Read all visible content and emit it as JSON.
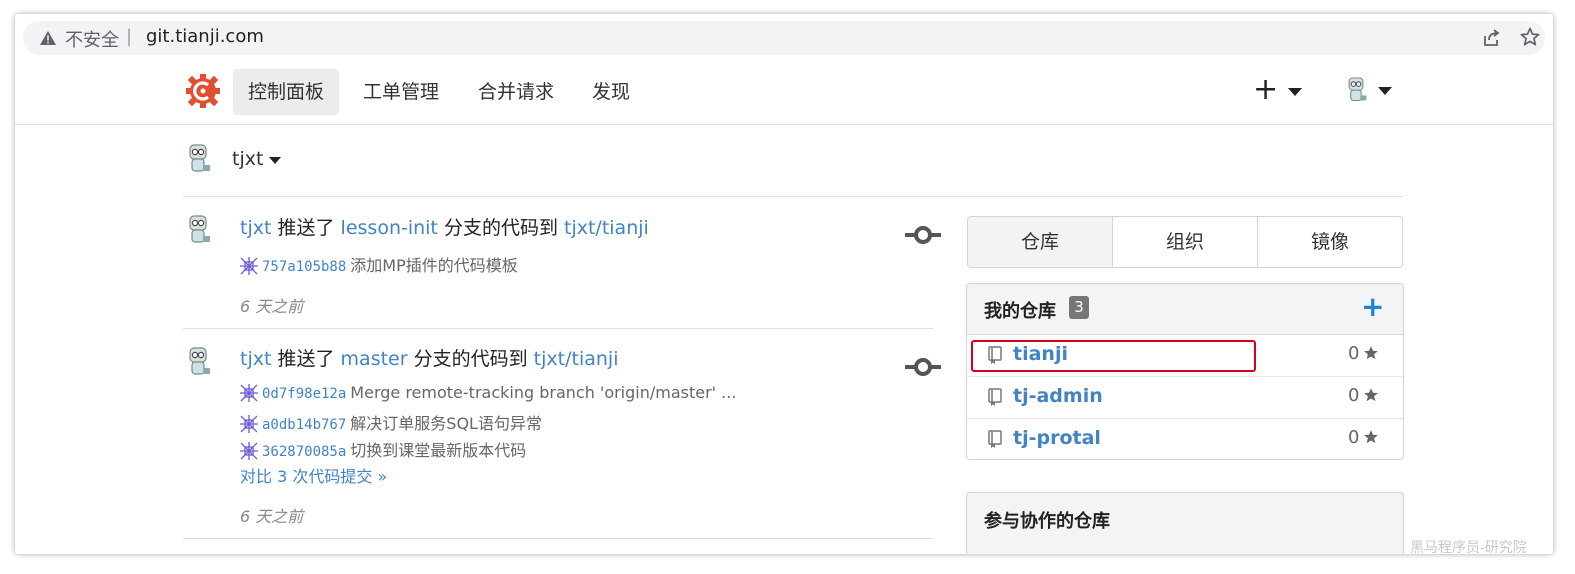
{
  "browser": {
    "security_label": "不安全",
    "separator": "|",
    "url": "git.tianji.com"
  },
  "nav": {
    "items": [
      "控制面板",
      "工单管理",
      "合并请求",
      "发现"
    ],
    "create_label": "+"
  },
  "context": {
    "user": "tjxt"
  },
  "feed": [
    {
      "user": "tjxt",
      "action": "推送了",
      "branch": "lesson-init",
      "mid": "分支的代码到",
      "repo": "tjxt/tianji",
      "commits": [
        {
          "sha": "757a105b88",
          "message": "添加MP插件的代码模板"
        }
      ],
      "compare": "",
      "time": "6 天之前"
    },
    {
      "user": "tjxt",
      "action": "推送了",
      "branch": "master",
      "mid": "分支的代码到",
      "repo": "tjxt/tianji",
      "commits": [
        {
          "sha": "0d7f98e12a",
          "message": "Merge remote-tracking branch 'origin/master' ..."
        },
        {
          "sha": "a0db14b767",
          "message": "解决订单服务SQL语句异常"
        },
        {
          "sha": "362870085a",
          "message": "切换到课堂最新版本代码"
        }
      ],
      "compare": "对比 3 次代码提交 »",
      "time": "6 天之前"
    }
  ],
  "sidebar": {
    "tabs": [
      "仓库",
      "组织",
      "镜像"
    ],
    "my_repos_title": "我的仓库",
    "my_repos_count": "3",
    "add_label": "+",
    "repos": [
      {
        "name": "tianji",
        "stars": "0"
      },
      {
        "name": "tj-admin",
        "stars": "0"
      },
      {
        "name": "tj-protal",
        "stars": "0"
      }
    ],
    "collab_title": "参与协作的仓库"
  },
  "watermark": "黑马程序员-研究院",
  "colors": {
    "link": "#4183c4",
    "highlight": "#d9001b",
    "logo": "#e0502f"
  }
}
